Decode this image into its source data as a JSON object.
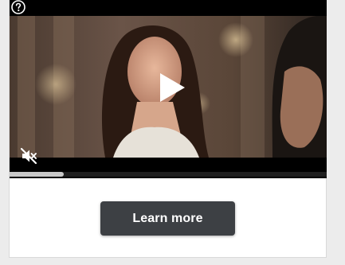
{
  "ad": {
    "cta_label": "Learn more",
    "progress_fraction": 0.17,
    "muted": true,
    "icons": {
      "help": "help-circle-icon",
      "play": "play-icon",
      "mute": "volume-muted-icon"
    },
    "colors": {
      "button_bg": "#3d4044",
      "button_text": "#ffffff",
      "video_bg": "#000000",
      "progress_fill": "#c8c8c8"
    }
  }
}
